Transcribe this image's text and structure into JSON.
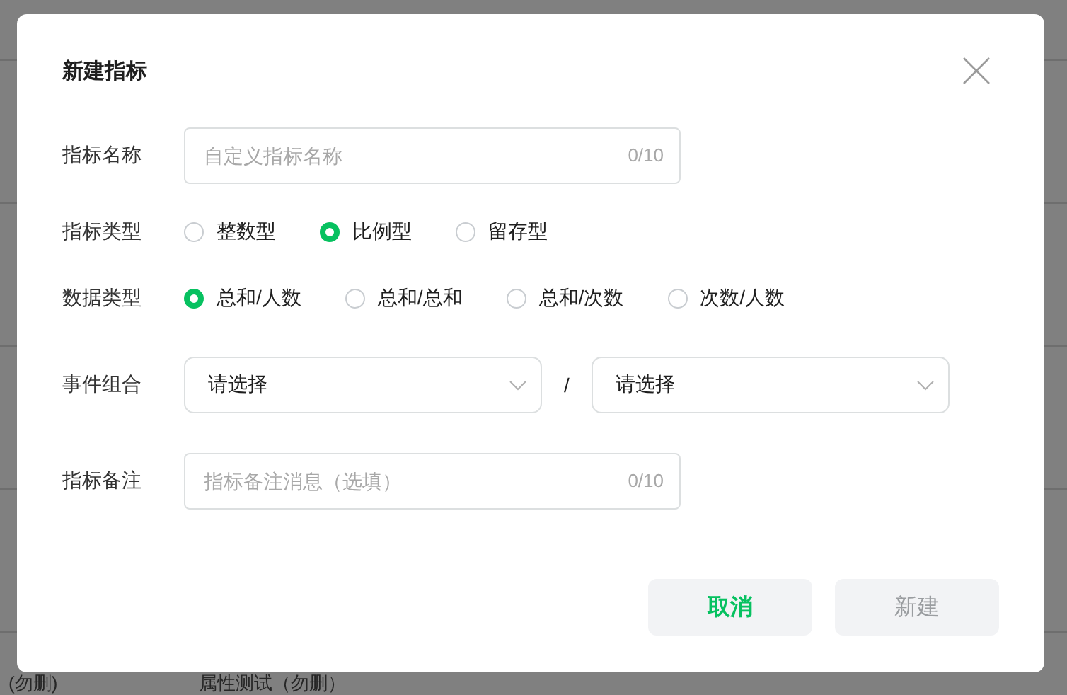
{
  "background": {
    "row_texts": [
      "(勿删)",
      "属性测试（勿删）"
    ]
  },
  "dialog": {
    "title": "新建指标",
    "fields": [
      {
        "kind": "text",
        "label": "指标名称",
        "placeholder": "自定义指标名称",
        "counter": "0/10"
      },
      {
        "kind": "radio",
        "label": "指标类型",
        "options": [
          {
            "label": "整数型",
            "selected": false
          },
          {
            "label": "比例型",
            "selected": true
          },
          {
            "label": "留存型",
            "selected": false
          }
        ]
      },
      {
        "kind": "radio",
        "label": "数据类型",
        "options": [
          {
            "label": "总和/人数",
            "selected": true
          },
          {
            "label": "总和/总和",
            "selected": false
          },
          {
            "label": "总和/次数",
            "selected": false
          },
          {
            "label": "次数/人数",
            "selected": false
          }
        ]
      },
      {
        "kind": "select_pair",
        "label": "事件组合",
        "left": "请选择",
        "separator": "/",
        "right": "请选择"
      },
      {
        "kind": "text",
        "label": "指标备注",
        "placeholder": "指标备注消息（选填）",
        "counter": "0/10"
      }
    ],
    "buttons": [
      {
        "label": "取消",
        "kind": "secondary",
        "disabled": false
      },
      {
        "label": "新建",
        "kind": "primary",
        "disabled": true
      }
    ]
  }
}
